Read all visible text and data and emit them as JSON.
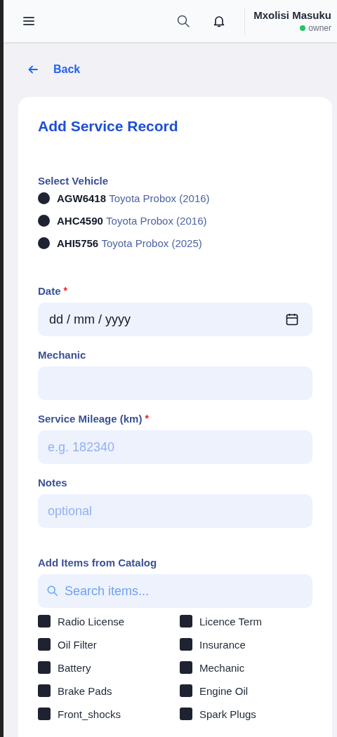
{
  "header": {
    "user_name": "Mxolisi Masuku",
    "role": "owner"
  },
  "back_link": "Back",
  "form": {
    "title": "Add Service Record",
    "vehicle_label": "Select Vehicle",
    "vehicles": [
      {
        "plate": "AGW6418",
        "model": "Toyota Probox (2016)",
        "selected": false
      },
      {
        "plate": "AHC4590",
        "model": "Toyota Probox (2016)",
        "selected": false
      },
      {
        "plate": "AHI5756",
        "model": "Toyota Probox (2025)",
        "selected": false
      }
    ],
    "fields": [
      {
        "label": "Date",
        "required_mark": "*",
        "kind": "date",
        "value": "dd / mm / yyyy"
      },
      {
        "label": "Mechanic",
        "kind": "text"
      },
      {
        "label": "Service Mileage (km)",
        "required_mark": "*",
        "kind": "text",
        "placeholder": "e.g. 182340"
      },
      {
        "label": "Notes",
        "kind": "text",
        "placeholder": "optional"
      }
    ],
    "catalog_label": "Add Items from Catalog",
    "search_placeholder": "Search items...",
    "items": [
      {
        "name": "Radio License",
        "checked": false
      },
      {
        "name": "Licence Term",
        "checked": false
      },
      {
        "name": "Oil Filter",
        "checked": false
      },
      {
        "name": "Insurance",
        "checked": false
      },
      {
        "name": "Battery",
        "checked": false
      },
      {
        "name": "Mechanic",
        "checked": false
      },
      {
        "name": "Brake Pads",
        "checked": false
      },
      {
        "name": "Engine Oil",
        "checked": false
      },
      {
        "name": "Front_shocks",
        "checked": false
      },
      {
        "name": "Spark Plugs",
        "checked": false
      }
    ]
  }
}
